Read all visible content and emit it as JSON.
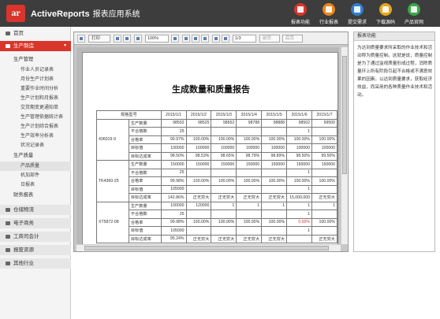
{
  "header": {
    "logo_text": "ar",
    "brand": "ActiveReports",
    "subtitle": "报表应用系统",
    "buttons": [
      {
        "label": "报表功能",
        "color": "#d9352b",
        "icon": "report-icon"
      },
      {
        "label": "行业报表",
        "color": "#e8861c",
        "icon": "industry-icon"
      },
      {
        "label": "提交需求",
        "color": "#2f7fd0",
        "icon": "submit-icon"
      },
      {
        "label": "下载源码",
        "color": "#e8a61c",
        "icon": "download-icon"
      },
      {
        "label": "产品官网",
        "color": "#3aa84a",
        "icon": "website-icon"
      }
    ]
  },
  "sidebar": {
    "home": "首页",
    "production": "生产制造",
    "production_mgmt": "生产管理",
    "mgmt_items": [
      "作业人员记录表",
      "月份生产计划表",
      "重要作业时间分析",
      "生产计划和月报表",
      "交货期变更通知单",
      "生产管理依据统计表",
      "生产计划综合报表",
      "生产效率分析表",
      "状况记录表"
    ],
    "quality": "生产质量",
    "quality_items": [
      "产品质量",
      "机加部件",
      "日报表"
    ],
    "finance": "财务报表",
    "groups": [
      "仓储物流",
      "电子商务",
      "工商司会计",
      "报废资源",
      "其他行业"
    ]
  },
  "toolbar": {
    "print": "打印",
    "zoom": "100%",
    "page": "1/3",
    "prev": "前页",
    "next": "后页"
  },
  "report": {
    "title": "生成数量和质量报告",
    "col_header": "规格型号",
    "dates": [
      "2015/1/1",
      "2015/1/2",
      "2015/1/3",
      "2015/1/4",
      "2015/1/5",
      "2015/1/6",
      "2015/1/7"
    ],
    "groups": [
      {
        "name": "436019-9",
        "rows": [
          {
            "label": "生产数量",
            "cells": [
              "98502",
              "98525",
              "98652",
              "98788",
              "98888",
              "98502",
              "99500"
            ]
          },
          {
            "label": "不合格数",
            "cells": [
              "25",
              "",
              "",
              "",
              "",
              "1",
              ""
            ]
          },
          {
            "label": "合格率",
            "cells": [
              "99.97%",
              "100.00%",
              "100.00%",
              "100.00%",
              "100.00%",
              "100.00%",
              "100.00%"
            ]
          },
          {
            "label": "目标值",
            "cells": [
              "100000",
              "100000",
              "100000",
              "100000",
              "100000",
              "100000",
              "100000"
            ]
          },
          {
            "label": "目标达成率",
            "cells": [
              "98.50%",
              "98.53%",
              "98.65%",
              "98.79%",
              "98.89%",
              "98.50%",
              "99.50%"
            ]
          }
        ]
      },
      {
        "name": "TK4360-25",
        "rows": [
          {
            "label": "生产数量",
            "cells": [
              "150000",
              "150000",
              "150000",
              "150000",
              "150000",
              "150000",
              "150000"
            ]
          },
          {
            "label": "不合格数",
            "cells": [
              "25",
              "",
              "",
              "",
              "",
              "1",
              ""
            ]
          },
          {
            "label": "合格率",
            "cells": [
              "99.98%",
              "100.00%",
              "100.00%",
              "100.00%",
              "100.00%",
              "100.00%",
              "100.00%"
            ]
          },
          {
            "label": "目标值",
            "cells": [
              "105000",
              "",
              "",
              "",
              "",
              "1",
              ""
            ]
          },
          {
            "label": "目标达成率",
            "cells": [
              "142.86%",
              "正无穷大",
              "正无穷大",
              "正无穷大",
              "正无穷大",
              "15,000,000",
              "正无穷大"
            ]
          }
        ]
      },
      {
        "name": "XT5872-08",
        "rows": [
          {
            "label": "生产数量",
            "cells": [
              "100000",
              "120000",
              "1",
              "1",
              "1",
              "1",
              "1"
            ]
          },
          {
            "label": "不合格数",
            "cells": [
              "25",
              "",
              "",
              "",
              "",
              "1",
              ""
            ]
          },
          {
            "label": "合格率",
            "cells": [
              "99.98%",
              "100.00%",
              "100.00%",
              "100.00%",
              "100.00%",
              "0.00%",
              "100.00%"
            ]
          },
          {
            "label": "目标值",
            "cells": [
              "105000",
              "",
              "",
              "",
              "",
              "1",
              ""
            ]
          },
          {
            "label": "目标达成率",
            "cells": [
              "95.24%",
              "正无穷大",
              "正无穷大",
              "正无穷大",
              "正无穷大",
              "",
              "正无穷大"
            ]
          }
        ]
      }
    ]
  },
  "panel": {
    "title": "报表功能",
    "body": "为达到质量要求所采取的作业技术和活动称为质量控制。这就是说，质量控制是为了通过监视质量形成过程，消除质量环上所有阶段引起不合格或不满意效果的因素。以达到质量要求，获取经济效益，而采用的各种质量作业技术和活动。"
  }
}
